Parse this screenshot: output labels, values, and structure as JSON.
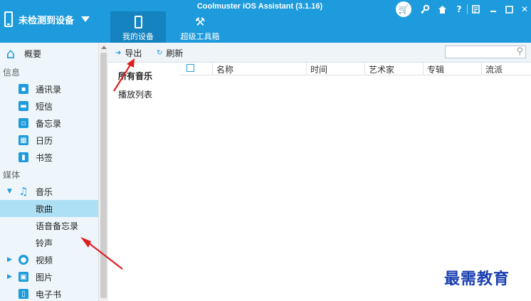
{
  "titlebar": {
    "device_label": "未检测到设备",
    "app_title": "Coolmuster iOS Assistant (3.1.16)",
    "tabs": [
      {
        "label": "我的设备",
        "icon": "phone-icon",
        "active": true
      },
      {
        "label": "超级工具箱",
        "icon": "tools-icon",
        "active": false
      }
    ],
    "window_buttons": [
      "cart-icon",
      "key-icon",
      "home-icon",
      "help-icon",
      "feedback-icon",
      "minimize-icon",
      "maximize-icon",
      "close-icon"
    ],
    "help_label": "?",
    "close_label": "✕",
    "accent_color": "#1e9bdc"
  },
  "sidebar": {
    "overview": "概要",
    "section_info": "信息",
    "section_media": "媒体",
    "info_items": [
      {
        "label": "通讯录",
        "icon": "contacts-icon"
      },
      {
        "label": "短信",
        "icon": "messages-icon"
      },
      {
        "label": "备忘录",
        "icon": "notes-icon"
      },
      {
        "label": "日历",
        "icon": "calendar-icon"
      },
      {
        "label": "书签",
        "icon": "bookmarks-icon"
      }
    ],
    "music": {
      "label": "音乐",
      "icon": "music-icon"
    },
    "music_children": [
      {
        "label": "歌曲",
        "selected": true
      },
      {
        "label": "语音备忘录",
        "selected": false
      },
      {
        "label": "铃声",
        "selected": false
      }
    ],
    "video": {
      "label": "视频",
      "icon": "video-icon"
    },
    "photos": {
      "label": "图片",
      "icon": "photos-icon"
    },
    "ebooks": {
      "label": "电子书",
      "icon": "ebook-icon"
    }
  },
  "toolbar": {
    "export_label": "导出",
    "refresh_label": "刷新",
    "search_placeholder": ""
  },
  "music_nav": {
    "all_music": "所有音乐",
    "playlists": "播放列表"
  },
  "table": {
    "columns": [
      "名称",
      "时间",
      "艺术家",
      "专辑",
      "流派"
    ],
    "rows": []
  },
  "watermark": "最需教育"
}
